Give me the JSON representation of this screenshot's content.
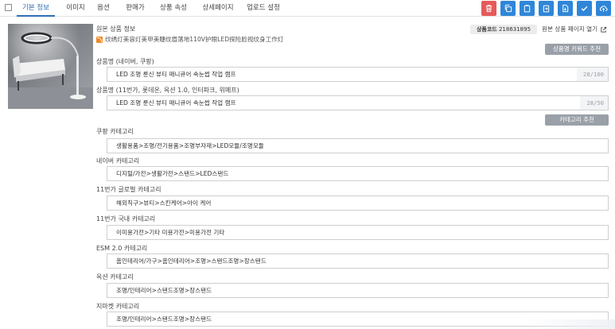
{
  "tabs": [
    {
      "label": "기본 정보"
    },
    {
      "label": "이미지"
    },
    {
      "label": "옵션"
    },
    {
      "label": "판매가"
    },
    {
      "label": "상품 속성"
    },
    {
      "label": "상세페이지"
    },
    {
      "label": "업로드 설정"
    }
  ],
  "toolbar": {
    "buttons": [
      {
        "icon": "trash-icon",
        "color": "#e55a5a"
      },
      {
        "icon": "copy-icon",
        "color": "#2f86d8"
      },
      {
        "icon": "clipboard-icon",
        "color": "#2f86d8"
      },
      {
        "icon": "paste-icon",
        "color": "#2f86d8"
      },
      {
        "icon": "file-export-icon",
        "color": "#2f86d8"
      },
      {
        "icon": "check-icon",
        "color": "#2f86d8"
      },
      {
        "icon": "cloud-upload-icon",
        "color": "#2f86d8"
      }
    ]
  },
  "origin": {
    "label": "원본 상품 정보",
    "name": "纹绣灯美容灯美甲美睫纹眉落地110V护眼LED探险脸视纹身工作灯",
    "code_label": "상품코드",
    "code_value": "218631895",
    "open_label": "원본 상품 페이지 열기"
  },
  "keyword_button": "상품명 키워드 추천",
  "category_button": "카테고리 추천",
  "product_name": {
    "label": "상품명 (네이버, 쿠팡)",
    "value": "LED 조명 룬신 뷰티 매니큐어 속눈썹 작업 램프",
    "counter": "28/100"
  },
  "product_name_11": {
    "label": "상품명 (11번가, 롯데온, 옥션 1.0, 인터파크, 위메프)",
    "value": "LED 조명 룬신 뷰티 매니큐어 속눈썹 작업 램프",
    "counter": "28/50"
  },
  "categories": [
    {
      "label": "쿠팡 카테고리",
      "value": "생활용품>조명/전기용품>조명부자재>LED모듈/조명모듈"
    },
    {
      "label": "네이버 카테고리",
      "value": "디지털/가전>생활가전>스탠드>LED스탠드"
    },
    {
      "label": "11번가 글로벌 카테고리",
      "value": "해외직구>뷰티>스킨케어>아이 케어"
    },
    {
      "label": "11번가 국내 카테고리",
      "value": "이미용가전>기타 미용가전>미용가전 기타"
    },
    {
      "label": "ESM 2.0 카테고리",
      "value": "홈인테리어/가구>홈인테리어>조명>스탠드조명>장스탠드"
    },
    {
      "label": "옥션 카테고리",
      "value": "조명/인테리어>스탠드조명>장스탠드"
    },
    {
      "label": "지마켓 카테고리",
      "value": "조명/인테리어>스탠드조명>장스탠드"
    }
  ]
}
